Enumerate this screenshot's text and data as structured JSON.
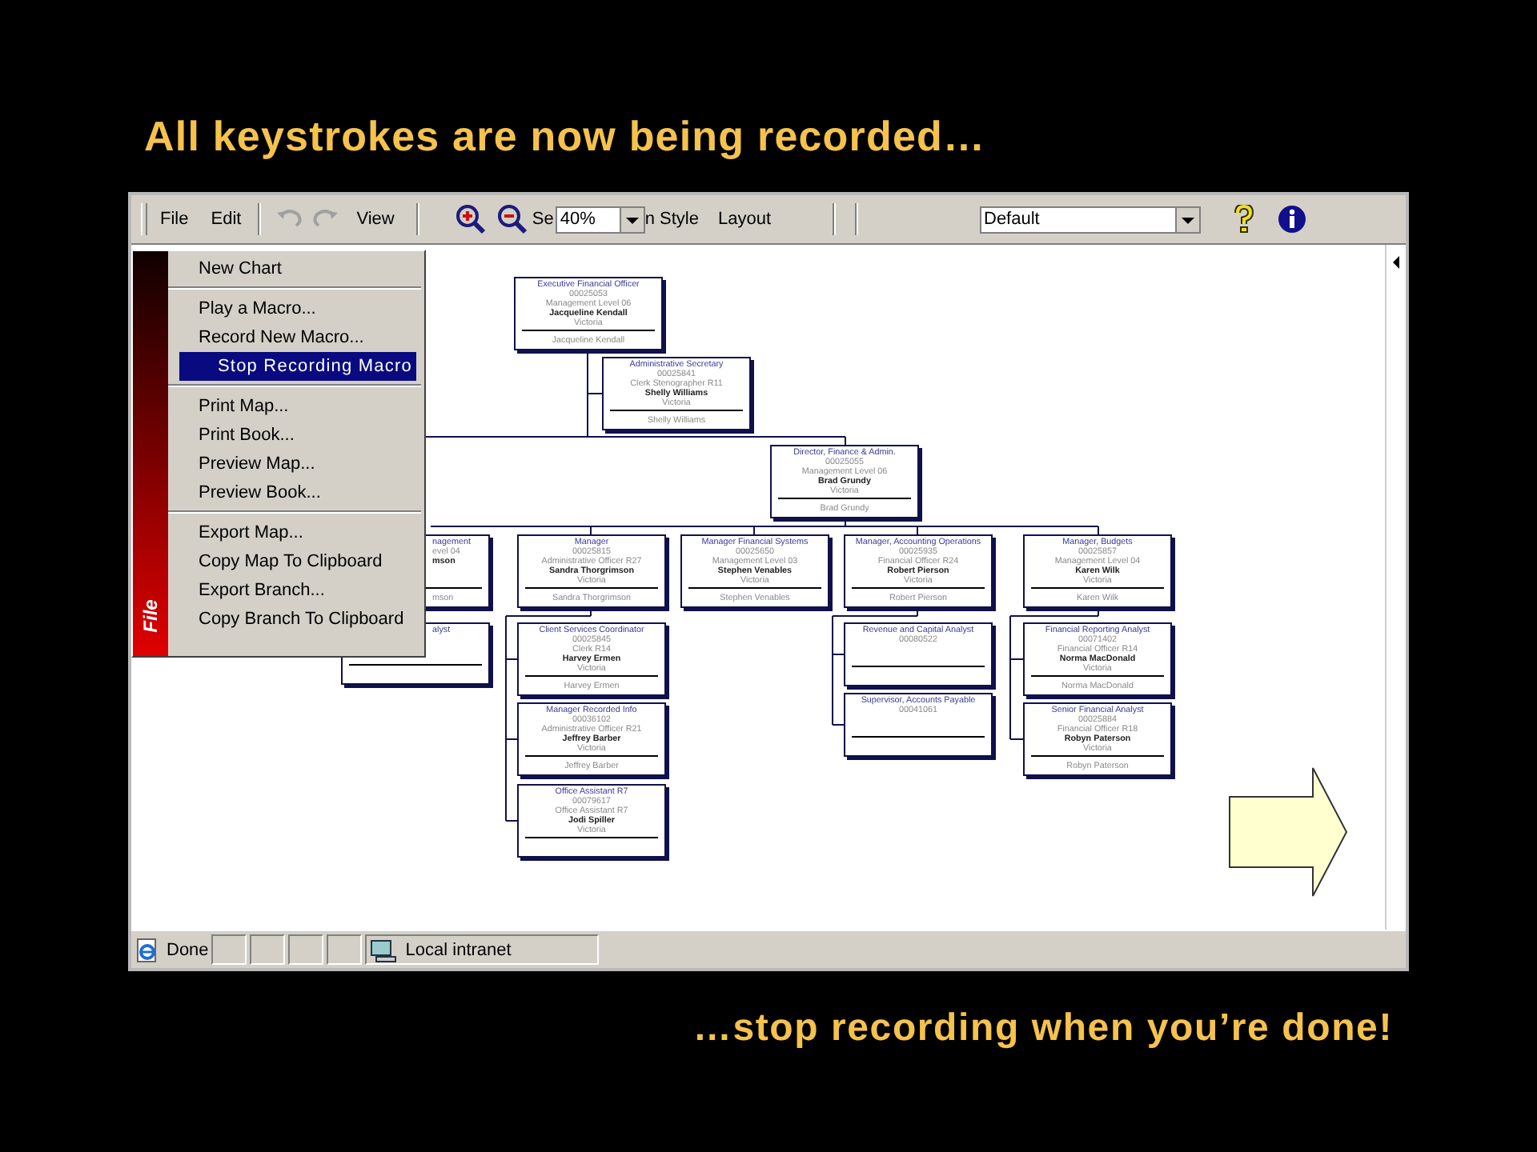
{
  "slide": {
    "title": "All keystrokes are now being recorded…",
    "footer": "…stop recording when you’re done!"
  },
  "toolbar": {
    "menus": [
      "File",
      "Edit"
    ],
    "view": "View",
    "obscured_label_start": "Se",
    "zoom": {
      "value": "40%"
    },
    "obscured_label_end": "n Style",
    "layout": "Layout",
    "template": {
      "value": "Default"
    }
  },
  "file_menu": {
    "side_label": "File",
    "groups": [
      [
        {
          "label": "New Chart",
          "selected": false
        }
      ],
      [
        {
          "label": "Play a Macro...",
          "selected": false
        },
        {
          "label": "Record New Macro...",
          "selected": false
        },
        {
          "label": "Stop Recording Macro",
          "selected": true
        }
      ],
      [
        {
          "label": "Print Map...",
          "selected": false
        },
        {
          "label": "Print Book...",
          "selected": false
        },
        {
          "label": "Preview Map...",
          "selected": false
        },
        {
          "label": "Preview Book...",
          "selected": false
        }
      ],
      [
        {
          "label": "Export Map...",
          "selected": false
        },
        {
          "label": "Copy Map To Clipboard",
          "selected": false
        },
        {
          "label": "Export Branch...",
          "selected": false
        },
        {
          "label": "Copy Branch To Clipboard",
          "selected": false
        }
      ]
    ]
  },
  "org_chart": {
    "nodes": [
      {
        "kind": "full",
        "title": "Executive Financial Officer",
        "id": "00025053",
        "role": "Management Level 06",
        "name": "Jacqueline Kendall",
        "place": "Victoria",
        "footer": "Jacqueline Kendall"
      },
      {
        "kind": "full",
        "title": "Administrative Secretary",
        "id": "00025841",
        "role": "Clerk Stenographer R11",
        "name": "Shelly Williams",
        "place": "Victoria",
        "footer": "Shelly Williams"
      },
      {
        "kind": "full",
        "title": "Director, Finance & Admin.",
        "id": "00025055",
        "role": "Management Level 06",
        "name": "Brad Grundy",
        "place": "Victoria",
        "footer": "Brad Grundy"
      },
      {
        "kind": "partial",
        "title": "nagement",
        "role": "evel 04",
        "name": "mson",
        "footer": "mson"
      },
      {
        "kind": "full",
        "title": "Manager",
        "id": "00025815",
        "role": "Administrative Officer R27",
        "name": "Sandra Thorgrimson",
        "place": "Victoria",
        "footer": "Sandra Thorgrimson"
      },
      {
        "kind": "full",
        "title": "Manager Financial Systems",
        "id": "00025650",
        "role": "Management Level 03",
        "name": "Stephen Venables",
        "place": "Victoria",
        "footer": "Stephen Venables"
      },
      {
        "kind": "full",
        "title": "Manager, Accounting Operations",
        "id": "00025935",
        "role": "Financial Officer R24",
        "name": "Robert Pierson",
        "place": "Victoria",
        "footer": "Robert Pierson"
      },
      {
        "kind": "full",
        "title": "Manager, Budgets",
        "id": "00025857",
        "role": "Management Level 04",
        "name": "Karen Wilk",
        "place": "Victoria",
        "footer": "Karen Wilk"
      },
      {
        "kind": "partial",
        "title": "alyst"
      },
      {
        "kind": "full",
        "title": "Client Services Coordinator",
        "id": "00025845",
        "role": "Clerk R14",
        "name": "Harvey Ermen",
        "place": "Victoria",
        "footer": "Harvey Ermen"
      },
      {
        "kind": "full",
        "title": "Revenue and Capital Analyst",
        "id": "00080522"
      },
      {
        "kind": "full",
        "title": "Financial Reporting Analyst",
        "id": "00071402",
        "role": "Financial Officer R14",
        "name": "Norma MacDonald",
        "place": "Victoria",
        "footer": "Norma MacDonald"
      },
      {
        "kind": "full",
        "title": "Manager Recorded Info",
        "id": "00036102",
        "role": "Administrative Officer R21",
        "name": "Jeffrey Barber",
        "place": "Victoria",
        "footer": "Jeffrey Barber"
      },
      {
        "kind": "full",
        "title": "Supervisor, Accounts Payable",
        "id": "00041061"
      },
      {
        "kind": "full",
        "title": "Senior Financial Analyst",
        "id": "00025884",
        "role": "Financial Officer R18",
        "name": "Robyn Paterson",
        "place": "Victoria",
        "footer": "Robyn Paterson"
      },
      {
        "kind": "full",
        "title": "Office Assistant R7",
        "id": "00079617",
        "role": "Office Assistant R7",
        "name": "Jodi Spiller",
        "place": "Victoria"
      }
    ]
  },
  "status_bar": {
    "text": "Done",
    "zone": "Local intranet"
  }
}
